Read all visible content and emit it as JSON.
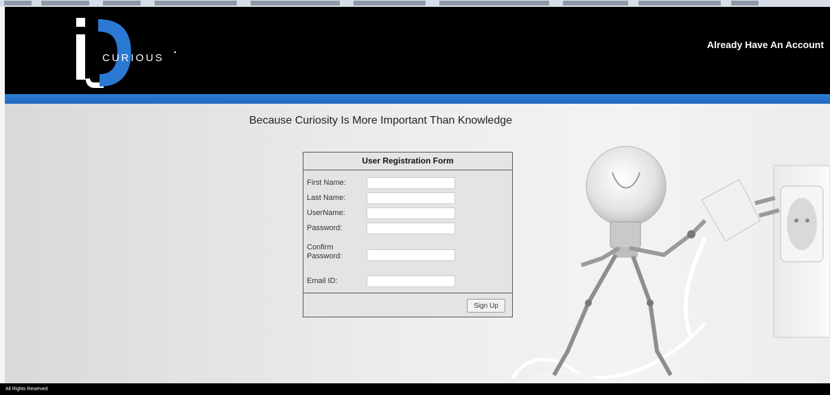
{
  "header": {
    "logo_text": "CURIOUS",
    "login_link": "Already Have An Account"
  },
  "main": {
    "tagline": "Because Curiosity Is More Important Than Knowledge"
  },
  "form": {
    "title": "User Registration Form",
    "fields": [
      {
        "label": "First Name:",
        "value": ""
      },
      {
        "label": "Last Name:",
        "value": ""
      },
      {
        "label": "UserName:",
        "value": ""
      },
      {
        "label": "Password:",
        "value": ""
      },
      {
        "label": "Confirm Password:",
        "value": ""
      },
      {
        "label": "Email ID:",
        "value": ""
      }
    ],
    "submit_label": "Sign Up"
  },
  "footer": {
    "text": "All Rights Reserved"
  },
  "colors": {
    "header_bg": "#000000",
    "accent_blue": "#2b79d2",
    "page_bg": "#e9e9e9"
  }
}
